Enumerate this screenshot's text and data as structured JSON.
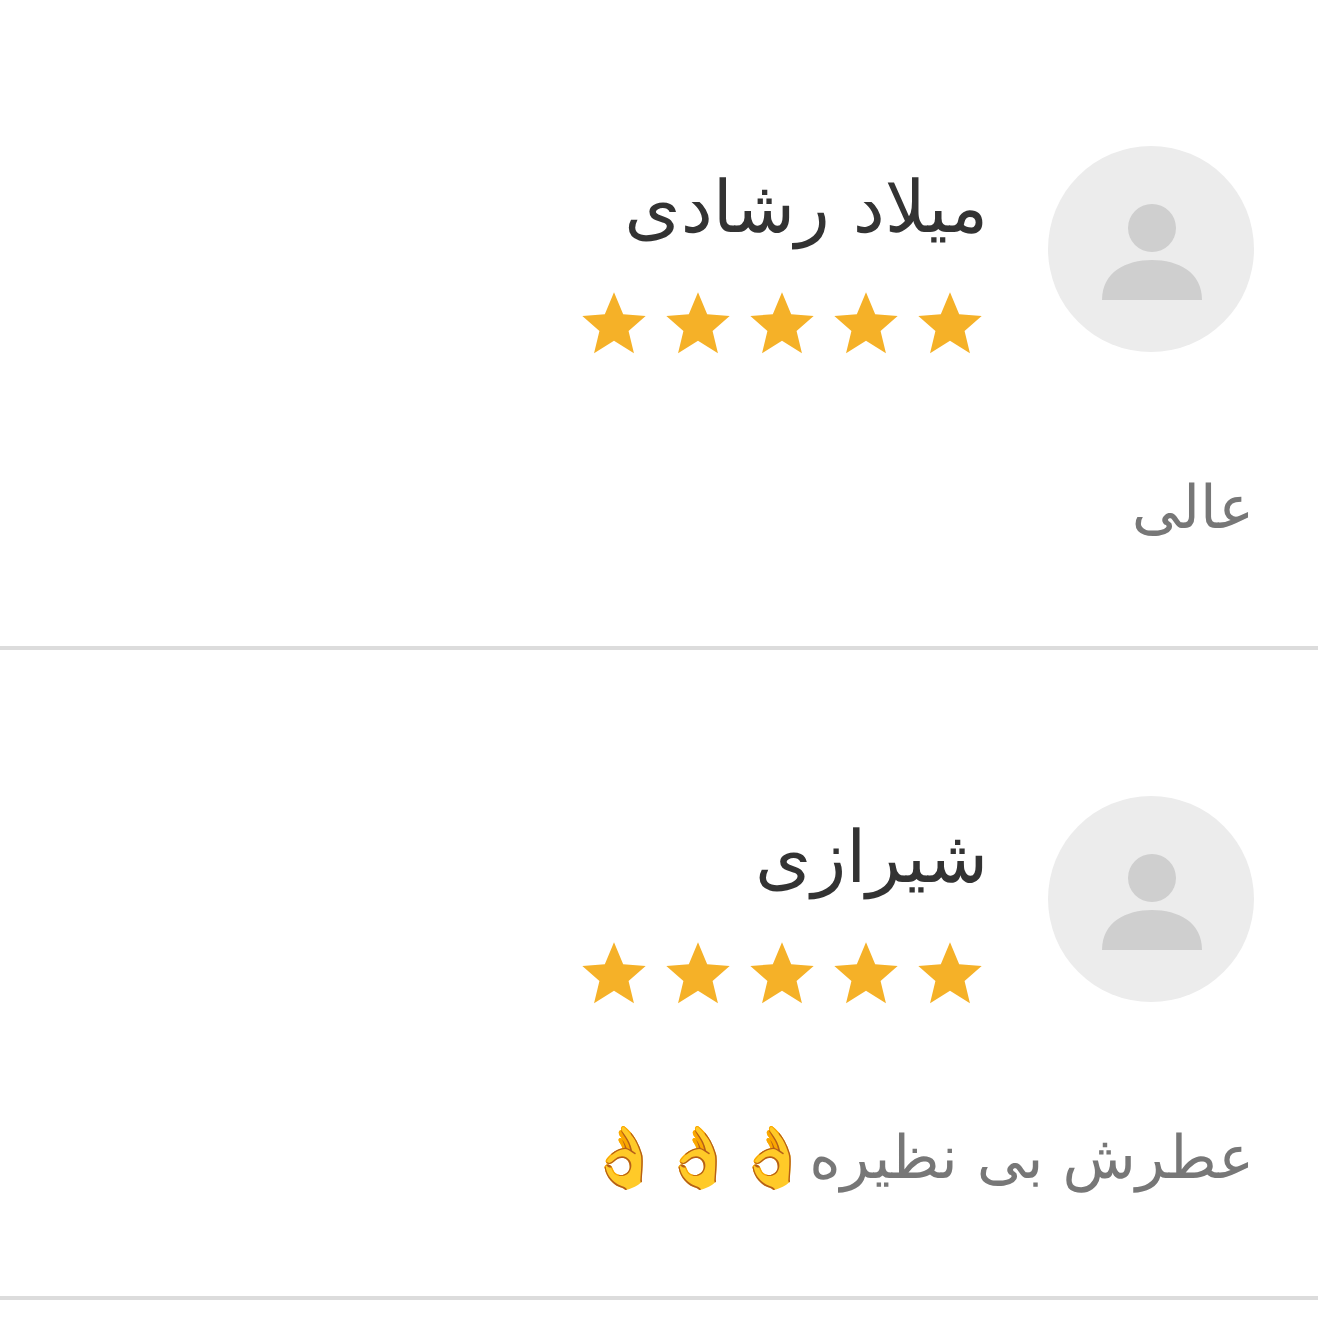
{
  "reviews": [
    {
      "name": "میلاد رشادی",
      "stars": 5,
      "comment": "عالی"
    },
    {
      "name": "شیرازی",
      "stars": 5,
      "comment": "عطرش بی نظیره👌👌👌"
    }
  ]
}
